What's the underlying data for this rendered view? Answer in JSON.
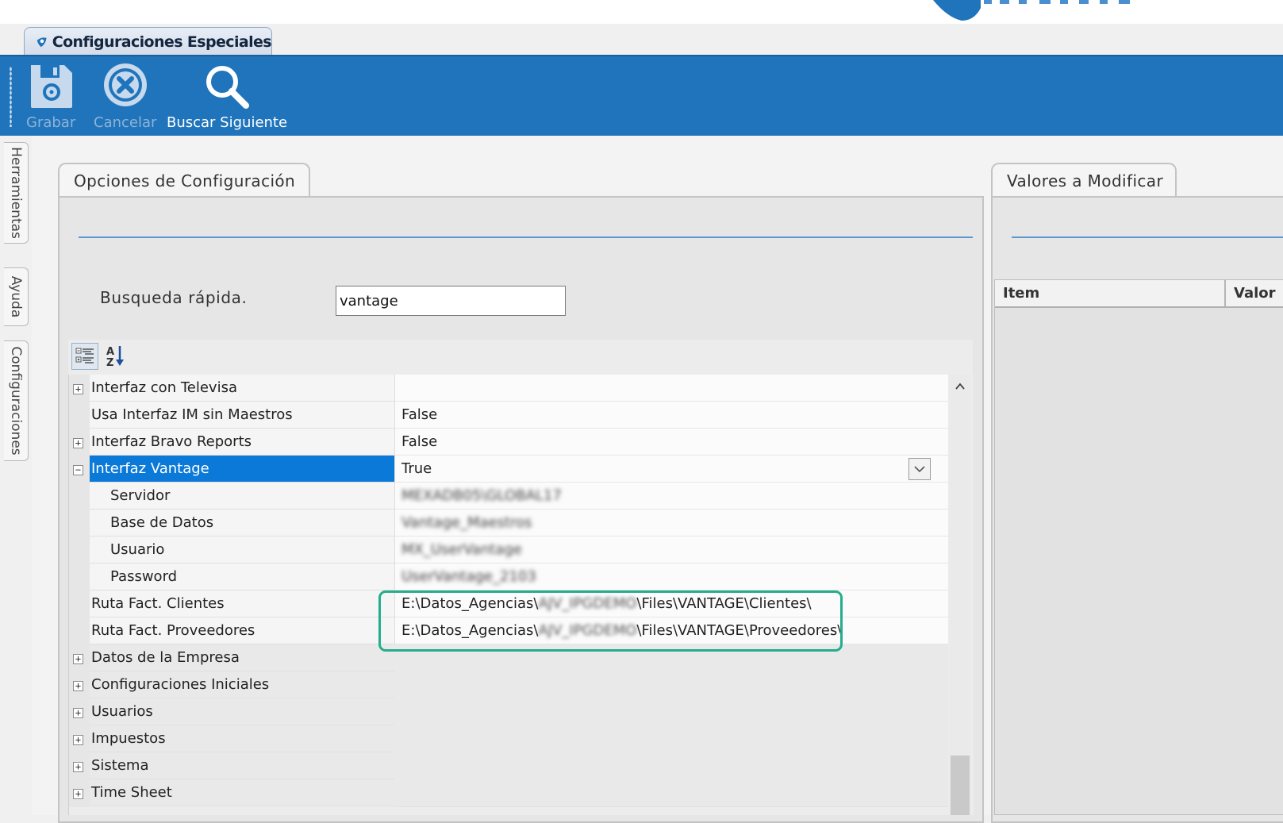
{
  "window": {
    "tab_title": "Configuraciones Especiales"
  },
  "ribbon": {
    "buttons": [
      {
        "label": "Grabar",
        "icon": "save-icon",
        "enabled": false
      },
      {
        "label": "Cancelar",
        "icon": "cancel-icon",
        "enabled": false
      },
      {
        "label": "Buscar Siguiente",
        "icon": "search-icon",
        "enabled": true
      }
    ]
  },
  "sidebar": {
    "tabs": [
      "Herramientas",
      "Ayuda",
      "Configuraciones"
    ]
  },
  "left_panel": {
    "title": "Opciones de Configuración",
    "search_label": "Busqueda rápida.",
    "search_value": "vantage"
  },
  "property_grid": {
    "toolbar": {
      "categorized_icon": "categorized-view-icon",
      "alphabetical_icon": "sort-az-icon"
    },
    "rows": [
      {
        "name": "Interfaz con Televisa",
        "value": "",
        "expander": "+",
        "indent": 0
      },
      {
        "name": "Usa Interfaz IM sin Maestros",
        "value": "False",
        "expander": "",
        "indent": 0
      },
      {
        "name": "Interfaz Bravo Reports",
        "value": "False",
        "expander": "+",
        "indent": 0
      },
      {
        "name": "Interfaz Vantage",
        "value": "True",
        "expander": "−",
        "indent": 0,
        "selected": true
      },
      {
        "name": "Servidor",
        "value": "MEXADB05\\GLOBAL17",
        "expander": "",
        "indent": 1,
        "blurred": true
      },
      {
        "name": "Base de Datos",
        "value": "Vantage_Maestros",
        "expander": "",
        "indent": 1,
        "blurred": true
      },
      {
        "name": "Usuario",
        "value": "MX_UserVantage",
        "expander": "",
        "indent": 1,
        "blurred": true
      },
      {
        "name": "Password",
        "value": "UserVantage_2103",
        "expander": "",
        "indent": 1,
        "blurred": true
      },
      {
        "name": "Ruta Fact. Clientes",
        "value_prefix": "E:\\Datos_Agencias\\",
        "value_hidden": "AJV_IPGDEMO",
        "value_suffix": "\\Files\\VANTAGE\\Clientes\\",
        "expander": "",
        "indent": 0
      },
      {
        "name": "Ruta Fact. Proveedores",
        "value_prefix": "E:\\Datos_Agencias\\",
        "value_hidden": "AJV_IPGDEMO",
        "value_suffix": "\\Files\\VANTAGE\\Proveedores\\",
        "expander": "",
        "indent": 0
      }
    ],
    "categories": [
      "Datos de la Empresa",
      "Configuraciones Iniciales",
      "Usuarios",
      "Impuestos",
      "Sistema",
      "Time Sheet"
    ]
  },
  "right_panel": {
    "title": "Valores a Modificar",
    "columns": [
      "Item",
      "Valor"
    ]
  },
  "colors": {
    "ribbon": "#1f74bb",
    "selection": "#0b79d8",
    "highlight": "#24ad8e",
    "accent_line": "#5b97cf"
  }
}
